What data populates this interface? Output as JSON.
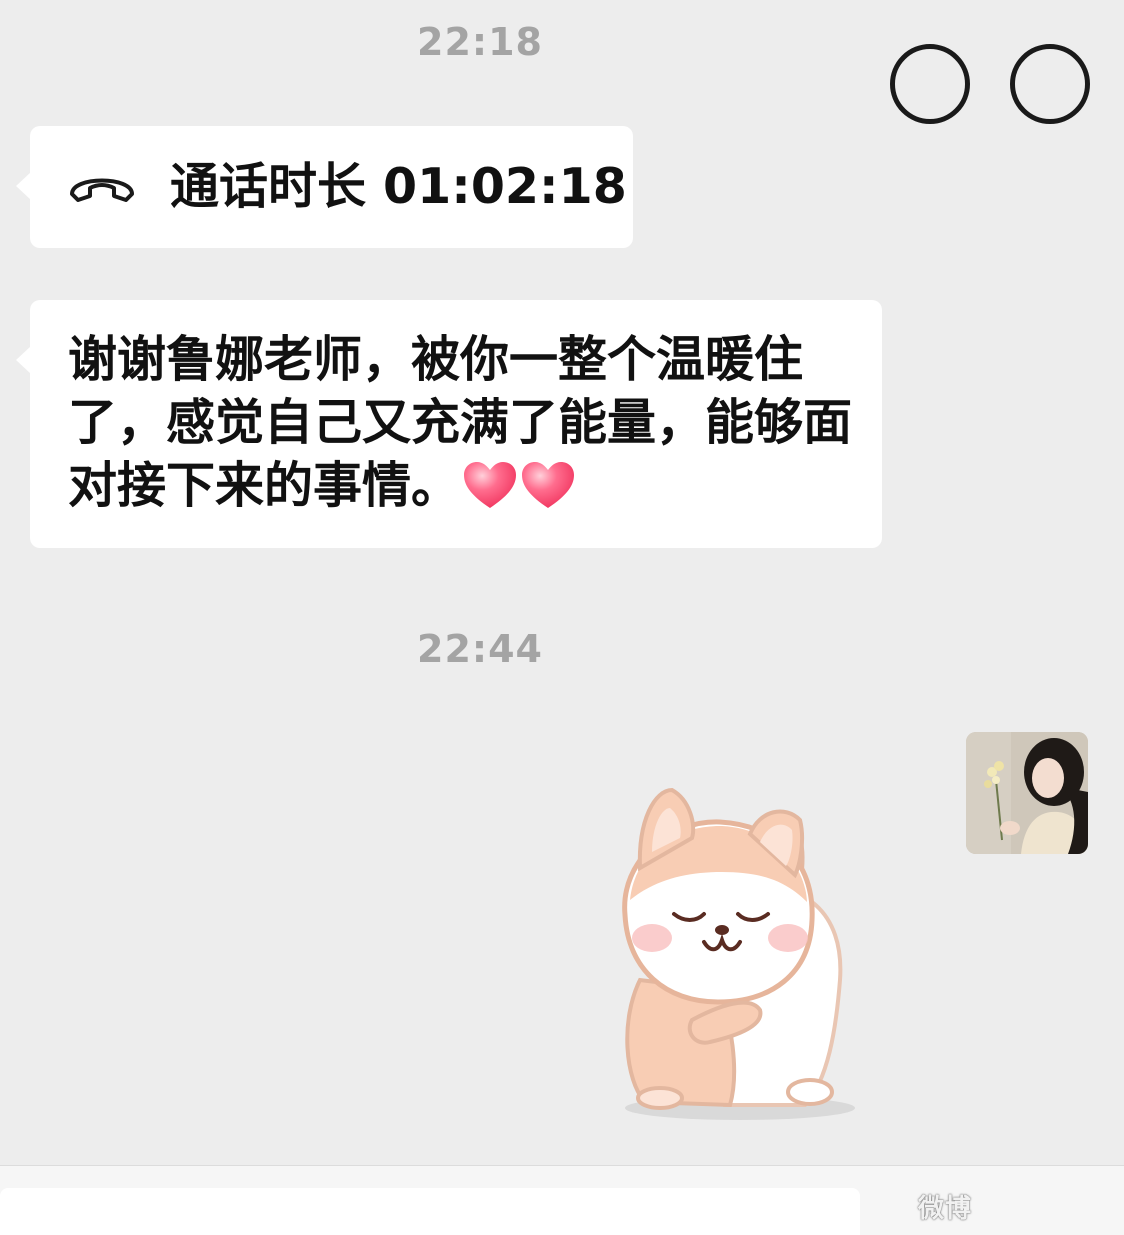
{
  "chat": {
    "timestamps": [
      "22:18",
      "22:44"
    ],
    "call_message": {
      "icon": "phone-hangup-icon",
      "text": "通话时长 01:02:18"
    },
    "text_message": {
      "text": "谢谢鲁娜老师，被你一整个温暖住了，感觉自己又充满了能量，能够面对接下来的事情。",
      "emoji": [
        "red-heart-icon",
        "red-heart-icon"
      ]
    },
    "sticker": {
      "icon": "hugging-dog-sticker"
    },
    "avatar": {
      "icon": "user-avatar-photo"
    }
  },
  "input_bar": {
    "emoji_icon": "emoji-face-icon",
    "more_icon": "plus-circle-icon"
  },
  "watermark": "微博"
}
